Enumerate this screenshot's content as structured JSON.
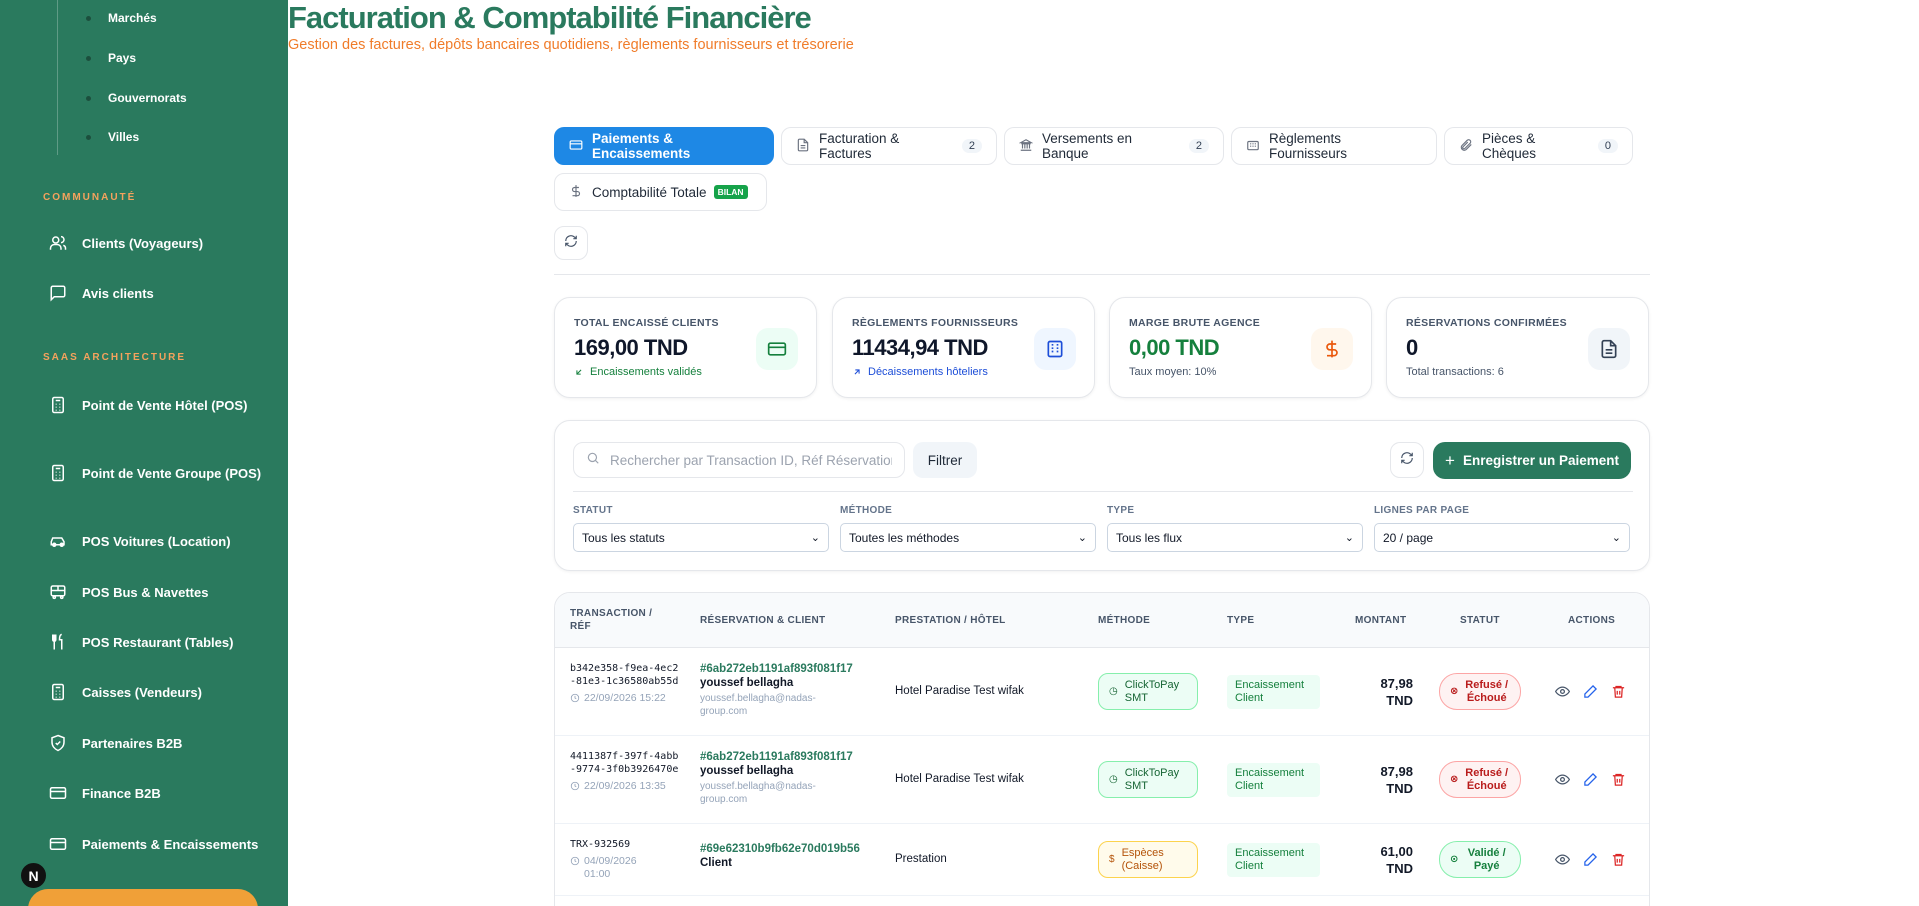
{
  "sidebar": {
    "sub_items": [
      "Marchés",
      "Pays",
      "Gouvernorats",
      "Villes"
    ],
    "sections": [
      {
        "title": "COMMUNAUTÉ",
        "items": [
          {
            "label": "Clients (Voyageurs)",
            "icon": "users-icon"
          },
          {
            "label": "Avis clients",
            "icon": "message-icon"
          }
        ]
      },
      {
        "title": "SAAS ARCHITECTURE",
        "items": [
          {
            "label": "Point de Vente Hôtel (POS)",
            "icon": "calculator-icon"
          },
          {
            "label": "Point de Vente Groupe (POS)",
            "icon": "calculator-icon"
          },
          {
            "label": "POS Voitures (Location)",
            "icon": "car-icon"
          },
          {
            "label": "POS Bus & Navettes",
            "icon": "bus-icon"
          },
          {
            "label": "POS Restaurant (Tables)",
            "icon": "utensils-icon"
          },
          {
            "label": "Caisses (Vendeurs)",
            "icon": "calculator-icon"
          },
          {
            "label": "Partenaires B2B",
            "icon": "shield-icon"
          },
          {
            "label": "Finance B2B",
            "icon": "credit-card-icon"
          },
          {
            "label": "Paiements & Encaissements",
            "icon": "credit-card-icon"
          }
        ]
      }
    ],
    "avatar_letter": "N"
  },
  "header": {
    "title": "Facturation & Comptabilité Financière",
    "subtitle": "Gestion des factures, dépôts bancaires quotidiens, règlements fournisseurs et trésorerie"
  },
  "tabs": [
    {
      "label": "Paiements & Encaissements",
      "active": true,
      "icon": "credit-card-icon"
    },
    {
      "label": "Facturation & Factures",
      "count": "2",
      "icon": "file-icon"
    },
    {
      "label": "Versements en Banque",
      "count": "2",
      "icon": "bank-icon"
    },
    {
      "label": "Règlements Fournisseurs",
      "icon": "building-icon"
    },
    {
      "label": "Pièces & Chèques",
      "count": "0",
      "icon": "paperclip-icon"
    },
    {
      "label": "Comptabilité Totale",
      "badge": "BILAN",
      "icon": "dollar-icon"
    }
  ],
  "kpis": [
    {
      "label": "TOTAL ENCAISSÉ CLIENTS",
      "value": "169,00 TND",
      "note": "Encaissements validés",
      "note_color": "#15803d",
      "value_color": "#0f172a",
      "icon": "credit-card-icon",
      "icon_bg": "#ecfdf5",
      "icon_color": "#15803d"
    },
    {
      "label": "RÈGLEMENTS FOURNISSEURS",
      "value": "11434,94 TND",
      "note": "Décaissements hôteliers",
      "note_color": "#1d4ed8",
      "value_color": "#0f172a",
      "icon": "building-icon",
      "icon_bg": "#eff6ff",
      "icon_color": "#1d4ed8"
    },
    {
      "label": "MARGE BRUTE AGENCE",
      "value": "0,00 TND",
      "note": "Taux moyen: 10%",
      "note_color": "#475569",
      "value_color": "#15803d",
      "icon": "dollar-icon",
      "icon_bg": "#fff7ed",
      "icon_color": "#ea580c"
    },
    {
      "label": "RÉSERVATIONS CONFIRMÉES",
      "value": "0",
      "note": "Total transactions: 6",
      "note_color": "#475569",
      "value_color": "#0f172a",
      "icon": "file-icon",
      "icon_bg": "#f1f5f9",
      "icon_color": "#334155"
    }
  ],
  "toolbar": {
    "search_placeholder": "Rechercher par Transaction ID, Réf Réservation",
    "filter_label": "Filtrer",
    "primary_label": "Enregistrer un Paiement"
  },
  "filters": [
    {
      "label": "STATUT",
      "value": "Tous les statuts"
    },
    {
      "label": "MÉTHODE",
      "value": "Toutes les méthodes"
    },
    {
      "label": "TYPE",
      "value": "Tous les flux"
    },
    {
      "label": "LIGNES PAR PAGE",
      "value": "20 / page"
    }
  ],
  "table": {
    "headers": [
      "TRANSACTION / RÉF",
      "RÉSERVATION & CLIENT",
      "PRESTATION / HÔTEL",
      "MÉTHODE",
      "TYPE",
      "MONTANT",
      "STATUT",
      "ACTIONS"
    ],
    "rows": [
      {
        "tx": "b342e358-f9ea-4ec2-81e3-1c36580ab55d",
        "date": "22/09/2026 15:22",
        "resa": "#6ab272eb1191af893f081f17",
        "client": "youssef bellagha",
        "email": "youssef.bellagha@nadas-group.com",
        "presta": "Hotel Paradise Test wifak",
        "method": "ClickToPay SMT",
        "type": "Encaissement Client",
        "amount": "87,98 TND",
        "status": "Refusé / Échoué",
        "status_kind": "refused"
      },
      {
        "tx": "4411387f-397f-4abb-9774-3f0b3926470e",
        "date": "22/09/2026 13:35",
        "resa": "#6ab272eb1191af893f081f17",
        "client": "youssef bellagha",
        "email": "youssef.bellagha@nadas-group.com",
        "presta": "Hotel Paradise Test wifak",
        "method": "ClickToPay SMT",
        "type": "Encaissement Client",
        "amount": "87,98 TND",
        "status": "Refusé / Échoué",
        "status_kind": "refused"
      },
      {
        "tx": "TRX-932569",
        "date": "04/09/2026 01:00",
        "resa": "#69e62310b9fb62e70d019b56",
        "client": "Client",
        "email": "",
        "presta": "Prestation",
        "method": "Espèces (Caisse)",
        "type": "Encaissement Client",
        "amount": "61,00 TND",
        "status": "Validé / Payé",
        "status_kind": "valid"
      }
    ]
  }
}
